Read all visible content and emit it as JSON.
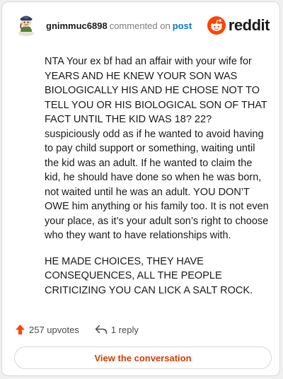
{
  "header": {
    "username": "gnimmuc6898",
    "action_text": "commented on",
    "post_link": "post",
    "brand": "reddit"
  },
  "comment": {
    "paragraphs": [
      "NTA Your ex bf had an affair with your wife for YEARS AND HE KNEW YOUR SON WAS BIOLOGICALLY HIS AND HE CHOSE NOT TO TELL YOU OR HIS BIOLOGICAL SON OF THAT FACT UNTIL THE KID WAS 18? 22? suspiciously odd as if he wanted to avoid having to pay child support or something, waiting until the kid was an adult. If he wanted to claim the kid, he should have done so when he was born, not waited until he was an adult. YOU DON’T OWE him anything or his family too. It is not even your place, as it’s your adult son’s right to choose who they want to have relationships with.",
      "HE MADE CHOICES, THEY HAVE CONSEQUENCES, ALL THE PEOPLE CRITICIZING YOU CAN LICK A SALT ROCK."
    ]
  },
  "actions": {
    "upvotes": "257 upvotes",
    "replies": "1 reply"
  },
  "footer": {
    "view_button": "View the conversation"
  },
  "icons": {
    "upvote": "upvote-arrow-icon",
    "reply": "reply-icon",
    "brand": "reddit-logo-icon",
    "avatar": "user-avatar-icon"
  },
  "colors": {
    "brand_orange": "#ff4500",
    "link_blue": "#0079d3",
    "button_text": "#d93a00",
    "upvote": "#ff4500"
  }
}
